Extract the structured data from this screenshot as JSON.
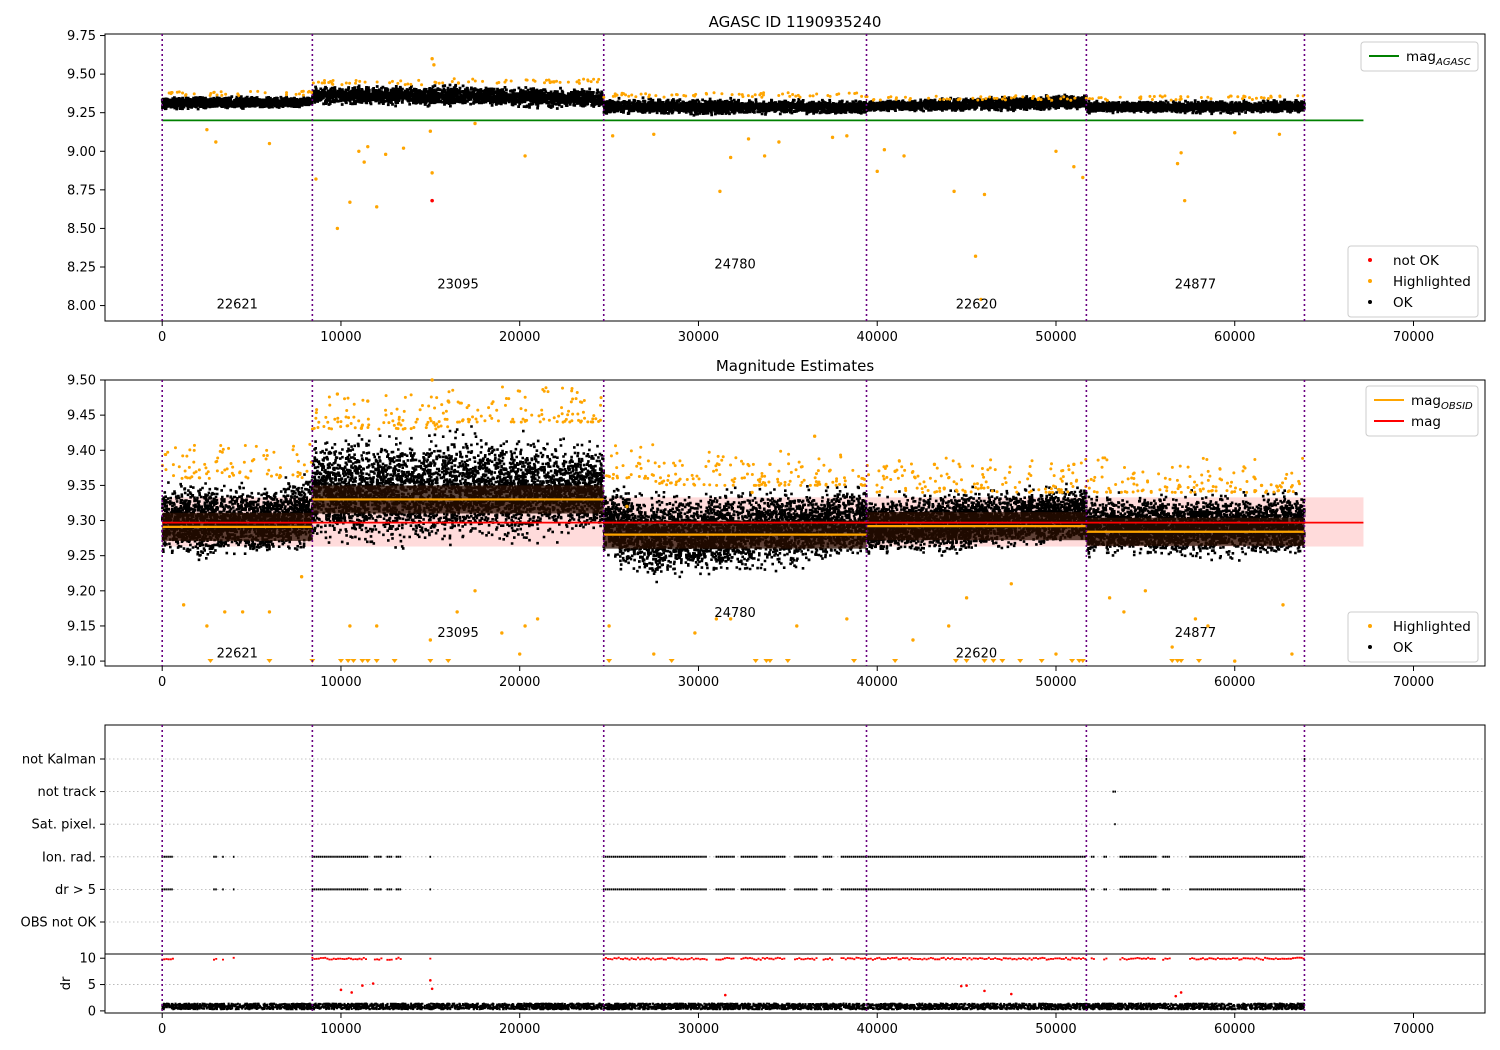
{
  "figure_title": "AGASC ID 1190935240",
  "panel2_title": "Magnitude Estimates",
  "colors": {
    "ok": "#000000",
    "highlighted": "#ffa500",
    "not_ok": "#ff0000",
    "mag_agasc": "#008000",
    "mag": "#ff0000",
    "mag_obsid": "#ffa500",
    "mag_band": "#ffcccc",
    "obs_boundary": "#6a0080",
    "obs_band": "#2a0d00"
  },
  "chart_data": [
    {
      "type": "scatter",
      "title": "AGASC ID 1190935240",
      "xlim": [
        -3200,
        74000
      ],
      "ylim": [
        7.9,
        9.76
      ],
      "x_ticks": [
        "0",
        "10000",
        "20000",
        "30000",
        "40000",
        "50000",
        "60000",
        "70000"
      ],
      "y_ticks": [
        "8.00",
        "8.25",
        "8.50",
        "8.75",
        "9.00",
        "9.25",
        "9.50",
        "9.75"
      ],
      "legend_upper": [
        {
          "label": "mag",
          "sub": "AGASC",
          "style": "line",
          "color": "#008000"
        }
      ],
      "legend_lower": [
        {
          "label": "not OK",
          "style": "dot",
          "color": "#ff0000"
        },
        {
          "label": "Highlighted",
          "style": "dot",
          "color": "#ffa500"
        },
        {
          "label": "OK",
          "style": "dot",
          "color": "#000000"
        }
      ],
      "mag_agasc": 9.2,
      "mag_agasc_x": [
        0,
        67200
      ],
      "obsids": [
        {
          "obsid": "22621",
          "start": 0,
          "end": 8400,
          "mean_mag": 9.3,
          "label_y": 7.98
        },
        {
          "obsid": "23095",
          "start": 8400,
          "end": 24700,
          "mean_mag": 9.35,
          "label_y": 8.11
        },
        {
          "obsid": "24780",
          "start": 24700,
          "end": 39400,
          "mean_mag": 9.28,
          "label_y": 8.24
        },
        {
          "obsid": "22620",
          "start": 39400,
          "end": 51700,
          "mean_mag": 9.29,
          "label_y": 7.98
        },
        {
          "obsid": "24877",
          "start": 51700,
          "end": 63900,
          "mean_mag": 9.29,
          "label_y": 8.11
        }
      ],
      "boundaries": [
        0,
        8400,
        24700,
        39400,
        51700,
        63900
      ],
      "ok_band": [
        {
          "x": 0,
          "lo": 9.26,
          "hi": 9.36
        },
        {
          "x": 8400,
          "lo": 9.28,
          "hi": 9.36
        },
        {
          "x": 8400,
          "lo": 9.29,
          "hi": 9.43
        },
        {
          "x": 16000,
          "lo": 9.28,
          "hi": 9.44
        },
        {
          "x": 24700,
          "lo": 9.27,
          "hi": 9.41
        },
        {
          "x": 24700,
          "lo": 9.23,
          "hi": 9.35
        },
        {
          "x": 39400,
          "lo": 9.23,
          "hi": 9.34
        },
        {
          "x": 39400,
          "lo": 9.25,
          "hi": 9.33
        },
        {
          "x": 51700,
          "lo": 9.26,
          "hi": 9.38
        },
        {
          "x": 51700,
          "lo": 9.24,
          "hi": 9.33
        },
        {
          "x": 63900,
          "lo": 9.24,
          "hi": 9.34
        }
      ],
      "highlighted_points": [
        [
          2500,
          9.14
        ],
        [
          3000,
          9.06
        ],
        [
          6000,
          9.05
        ],
        [
          8600,
          8.82
        ],
        [
          9800,
          8.5
        ],
        [
          10500,
          8.67
        ],
        [
          11000,
          9.0
        ],
        [
          11300,
          8.93
        ],
        [
          11500,
          9.03
        ],
        [
          12000,
          8.64
        ],
        [
          12500,
          8.98
        ],
        [
          13500,
          9.02
        ],
        [
          15000,
          9.13
        ],
        [
          15100,
          8.86
        ],
        [
          15100,
          9.6
        ],
        [
          15200,
          9.56
        ],
        [
          17500,
          9.18
        ],
        [
          20300,
          8.97
        ],
        [
          25200,
          9.1
        ],
        [
          27500,
          9.11
        ],
        [
          31200,
          8.74
        ],
        [
          31800,
          8.96
        ],
        [
          32800,
          9.08
        ],
        [
          33700,
          8.97
        ],
        [
          34500,
          9.06
        ],
        [
          37500,
          9.09
        ],
        [
          38300,
          9.1
        ],
        [
          40000,
          8.87
        ],
        [
          40400,
          9.01
        ],
        [
          41500,
          8.97
        ],
        [
          44300,
          8.74
        ],
        [
          45500,
          8.32
        ],
        [
          46000,
          8.72
        ],
        [
          45800,
          8.04
        ],
        [
          50000,
          9.0
        ],
        [
          51000,
          8.9
        ],
        [
          51500,
          8.83
        ],
        [
          56800,
          8.92
        ],
        [
          57000,
          8.99
        ],
        [
          57200,
          8.68
        ],
        [
          62500,
          9.11
        ],
        [
          60000,
          9.12
        ]
      ],
      "not_ok_points": [
        [
          15100,
          8.68
        ]
      ]
    },
    {
      "type": "scatter",
      "title": "Magnitude Estimates",
      "xlim": [
        -3200,
        74000
      ],
      "ylim": [
        9.093,
        9.5
      ],
      "x_ticks": [
        "0",
        "10000",
        "20000",
        "30000",
        "40000",
        "50000",
        "60000",
        "70000"
      ],
      "y_ticks": [
        "9.10",
        "9.15",
        "9.20",
        "9.25",
        "9.30",
        "9.35",
        "9.40",
        "9.45",
        "9.50"
      ],
      "legend_upper": [
        {
          "label": "mag",
          "sub": "OBSID",
          "style": "line",
          "color": "#ffa500"
        },
        {
          "label": "mag",
          "style": "line",
          "color": "#ff0000"
        }
      ],
      "legend_lower": [
        {
          "label": "Highlighted",
          "style": "dot",
          "color": "#ffa500"
        },
        {
          "label": "OK",
          "style": "dot",
          "color": "#000000"
        }
      ],
      "mag": 9.297,
      "mag_band": [
        9.263,
        9.333
      ],
      "mag_x": [
        0,
        67200
      ],
      "obsids": [
        {
          "obsid": "22621",
          "start": 0,
          "end": 8400,
          "mag_obsid": 9.291,
          "label_y": 9.105
        },
        {
          "obsid": "23095",
          "start": 8400,
          "end": 24700,
          "mag_obsid": 9.33,
          "label_y": 9.134
        },
        {
          "obsid": "24780",
          "start": 24700,
          "end": 39400,
          "mag_obsid": 9.28,
          "label_y": 9.163
        },
        {
          "obsid": "22620",
          "start": 39400,
          "end": 51700,
          "mag_obsid": 9.292,
          "label_y": 9.105
        },
        {
          "obsid": "24877",
          "start": 51700,
          "end": 63900,
          "mag_obsid": 9.284,
          "label_y": 9.134
        }
      ],
      "boundaries": [
        0,
        8400,
        24700,
        39400,
        51700,
        63900
      ],
      "ok_band": [
        {
          "x": 0,
          "lo": 9.24,
          "hi": 9.36
        },
        {
          "x": 6000,
          "lo": 9.24,
          "hi": 9.36
        },
        {
          "x": 8400,
          "lo": 9.25,
          "hi": 9.38
        },
        {
          "x": 8400,
          "lo": 9.25,
          "hi": 9.43
        },
        {
          "x": 16000,
          "lo": 9.25,
          "hi": 9.44
        },
        {
          "x": 24700,
          "lo": 9.27,
          "hi": 9.42
        },
        {
          "x": 24700,
          "lo": 9.24,
          "hi": 9.36
        },
        {
          "x": 27500,
          "lo": 9.2,
          "hi": 9.35
        },
        {
          "x": 39400,
          "lo": 9.24,
          "hi": 9.36
        },
        {
          "x": 39400,
          "lo": 9.24,
          "hi": 9.34
        },
        {
          "x": 51700,
          "lo": 9.26,
          "hi": 9.36
        },
        {
          "x": 51700,
          "lo": 9.24,
          "hi": 9.34
        },
        {
          "x": 63900,
          "lo": 9.24,
          "hi": 9.35
        }
      ],
      "highlighted_points": [
        [
          1200,
          9.18
        ],
        [
          2500,
          9.15
        ],
        [
          3500,
          9.17
        ],
        [
          4500,
          9.17
        ],
        [
          6000,
          9.17
        ],
        [
          7800,
          9.22
        ],
        [
          9800,
          9.48
        ],
        [
          10500,
          9.15
        ],
        [
          11500,
          9.47
        ],
        [
          12000,
          9.15
        ],
        [
          15000,
          9.13
        ],
        [
          15100,
          9.5
        ],
        [
          16000,
          9.47
        ],
        [
          16500,
          9.17
        ],
        [
          17500,
          9.2
        ],
        [
          19000,
          9.14
        ],
        [
          20000,
          9.11
        ],
        [
          20300,
          9.15
        ],
        [
          21000,
          9.16
        ],
        [
          25000,
          9.15
        ],
        [
          26000,
          9.32
        ],
        [
          27500,
          9.11
        ],
        [
          29800,
          9.14
        ],
        [
          31000,
          9.16
        ],
        [
          31800,
          9.16
        ],
        [
          33000,
          9.34
        ],
        [
          34000,
          9.38
        ],
        [
          35500,
          9.15
        ],
        [
          36500,
          9.42
        ],
        [
          38300,
          9.16
        ],
        [
          41000,
          9.37
        ],
        [
          42000,
          9.13
        ],
        [
          43200,
          9.38
        ],
        [
          44000,
          9.15
        ],
        [
          45000,
          9.19
        ],
        [
          47500,
          9.21
        ],
        [
          50000,
          9.11
        ],
        [
          51000,
          9.38
        ],
        [
          53000,
          9.19
        ],
        [
          53800,
          9.17
        ],
        [
          55000,
          9.2
        ],
        [
          56500,
          9.12
        ],
        [
          57800,
          9.16
        ],
        [
          58500,
          9.15
        ],
        [
          60000,
          9.1
        ],
        [
          61500,
          9.35
        ],
        [
          62700,
          9.18
        ],
        [
          63200,
          9.11
        ]
      ],
      "floor_markers": [
        2700,
        6000,
        8400,
        10000,
        10400,
        10700,
        11200,
        11500,
        12000,
        13000,
        15000,
        16000,
        25000,
        28500,
        33200,
        33800,
        34000,
        35000,
        38700,
        41000,
        44400,
        45000,
        46000,
        46500,
        47000,
        48000,
        49200,
        50900,
        51300,
        51500,
        56500,
        56800,
        57000,
        58000
      ],
      "legend_loc_note": "upper right / lower right"
    },
    {
      "type": "scatter",
      "title": "",
      "xlim": [
        -3200,
        74000
      ],
      "x_ticks": [
        "0",
        "10000",
        "20000",
        "30000",
        "40000",
        "50000",
        "60000",
        "70000"
      ],
      "flag_rows": [
        "not Kalman",
        "not track",
        "Sat. pixel.",
        "Ion. rad.",
        "dr > 5",
        "OBS not OK"
      ],
      "flag_points": {
        "not Kalman": [
          [
            51700,
            51750
          ],
          [
            63900,
            63950
          ]
        ],
        "not track": [
          [
            53200,
            53400
          ]
        ],
        "Sat. pixel.": [
          [
            53300,
            53350
          ]
        ],
        "Ion. rad.": [
          [
            0,
            600
          ],
          [
            2900,
            3100
          ],
          [
            3400,
            3500
          ],
          [
            4000,
            4100
          ],
          [
            8400,
            11500
          ],
          [
            11900,
            12300
          ],
          [
            12600,
            12900
          ],
          [
            13100,
            13400
          ],
          [
            15000,
            15100
          ],
          [
            24700,
            30500
          ],
          [
            31000,
            32000
          ],
          [
            32400,
            34900
          ],
          [
            35400,
            36700
          ],
          [
            37000,
            37500
          ],
          [
            38000,
            39400
          ],
          [
            39400,
            51700
          ],
          [
            52000,
            52200
          ],
          [
            52700,
            52900
          ],
          [
            53600,
            55600
          ],
          [
            56000,
            56400
          ],
          [
            57500,
            63900
          ]
        ],
        "dr > 5": [
          [
            0,
            600
          ],
          [
            2900,
            3100
          ],
          [
            3400,
            3500
          ],
          [
            4000,
            4100
          ],
          [
            8400,
            11500
          ],
          [
            11900,
            12300
          ],
          [
            12600,
            12900
          ],
          [
            13100,
            13400
          ],
          [
            15000,
            15100
          ],
          [
            24700,
            30500
          ],
          [
            31000,
            32000
          ],
          [
            32400,
            34900
          ],
          [
            35400,
            36700
          ],
          [
            37000,
            37500
          ],
          [
            38000,
            39400
          ],
          [
            39400,
            51700
          ],
          [
            52000,
            52200
          ],
          [
            52700,
            52900
          ],
          [
            53600,
            55600
          ],
          [
            56000,
            56400
          ],
          [
            57500,
            63900
          ]
        ],
        "OBS not OK": []
      },
      "boundaries": [
        0,
        8400,
        24700,
        39400,
        51700,
        63900
      ]
    },
    {
      "type": "scatter",
      "title": "",
      "ylabel": "dr",
      "xlim": [
        -3200,
        74000
      ],
      "ylim": [
        -0.4,
        10.8
      ],
      "x_ticks": [
        "0",
        "10000",
        "20000",
        "30000",
        "40000",
        "50000",
        "60000",
        "70000"
      ],
      "y_ticks": [
        "0",
        "5",
        "10"
      ],
      "capped_segments": [
        [
          0,
          600
        ],
        [
          2900,
          3100
        ],
        [
          3400,
          3500
        ],
        [
          4000,
          4100
        ],
        [
          8400,
          11500
        ],
        [
          11900,
          12300
        ],
        [
          12600,
          12900
        ],
        [
          13100,
          13400
        ],
        [
          15000,
          15100
        ],
        [
          24700,
          30500
        ],
        [
          31000,
          32000
        ],
        [
          32400,
          34900
        ],
        [
          35400,
          36700
        ],
        [
          37000,
          37500
        ],
        [
          38000,
          39400
        ],
        [
          39400,
          51700
        ],
        [
          52000,
          52200
        ],
        [
          52700,
          52900
        ],
        [
          53600,
          55600
        ],
        [
          56000,
          56400
        ],
        [
          57500,
          63900
        ]
      ],
      "mid_points": [
        [
          10000,
          4.0
        ],
        [
          10600,
          3.5
        ],
        [
          11200,
          4.8
        ],
        [
          11800,
          5.2
        ],
        [
          15000,
          5.8
        ],
        [
          15100,
          4.2
        ],
        [
          31500,
          3.0
        ],
        [
          44700,
          4.7
        ],
        [
          45000,
          4.8
        ],
        [
          46000,
          3.8
        ],
        [
          47500,
          3.2
        ],
        [
          56700,
          2.8
        ],
        [
          57000,
          3.5
        ]
      ],
      "base_level": [
        0.3,
        1.4
      ],
      "boundaries": [
        0,
        8400,
        24700,
        39400,
        51700,
        63900
      ]
    }
  ]
}
